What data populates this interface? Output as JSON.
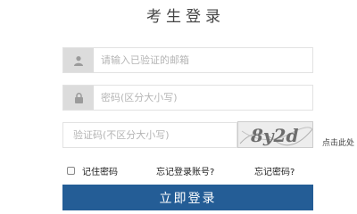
{
  "page": {
    "title": "考生登录"
  },
  "form": {
    "email_placeholder": "请输入已验证的邮箱",
    "password_placeholder": "密码(区分大小写)",
    "captcha_placeholder": "验证码(不区分大小写)",
    "captcha_text": "8y2d",
    "refresh_label": "点击此处",
    "remember_label": "记住密码",
    "forgot_account_label": "忘记登录账号?",
    "forgot_password_label": "忘记密码?",
    "login_button_label": "立即登录"
  },
  "colors": {
    "primary_button": "#245d96",
    "icon_background": "#dcdcdc"
  },
  "icons": {
    "email_icon": "user-icon",
    "password_icon": "lock-icon"
  }
}
